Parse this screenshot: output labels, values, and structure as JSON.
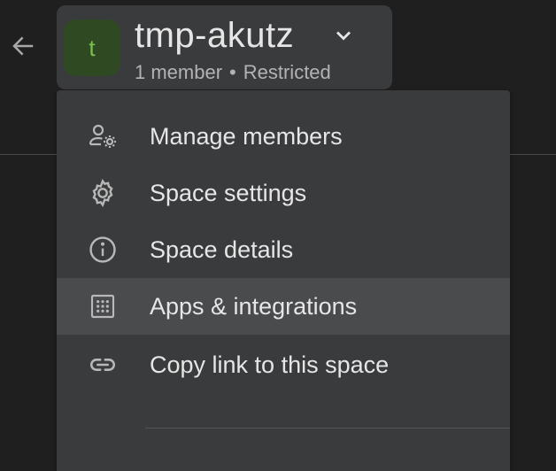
{
  "space": {
    "avatar_letter": "t",
    "name": "tmp-akutz",
    "members": "1 member",
    "separator": "•",
    "access": "Restricted"
  },
  "menu": {
    "items": [
      {
        "label": "Manage members",
        "icon": "manage-members-icon"
      },
      {
        "label": "Space settings",
        "icon": "gear-icon"
      },
      {
        "label": "Space details",
        "icon": "info-icon"
      },
      {
        "label": "Apps & integrations",
        "icon": "apps-grid-icon",
        "hovered": true
      },
      {
        "label": "Copy link to this space",
        "icon": "link-icon"
      }
    ]
  },
  "colors": {
    "background": "#1f1f1f",
    "panel": "#3a3b3d",
    "hover": "#4a4b4d",
    "avatar_bg": "#2f4a22",
    "avatar_fg": "#7ac14e",
    "text": "#e6e6e6"
  }
}
